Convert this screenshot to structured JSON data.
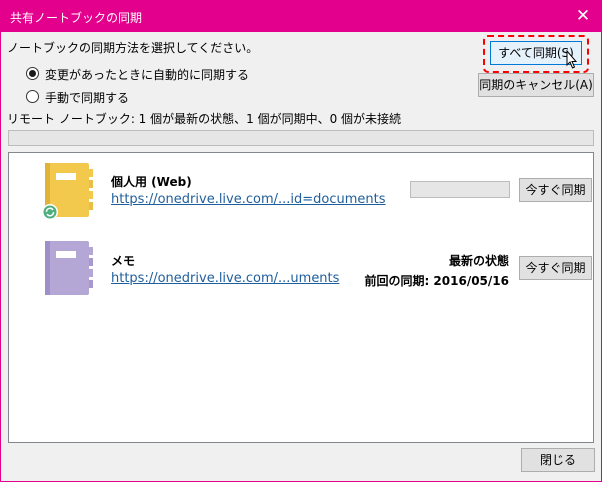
{
  "window": {
    "title": "共有ノートブックの同期"
  },
  "options": {
    "instruction": "ノートブックの同期方法を選択してください。",
    "radio_auto": "変更があったときに自動的に同期する",
    "radio_manual": "手動で同期する"
  },
  "buttons": {
    "sync_all": "すべて同期(S)",
    "cancel_sync": "同期のキャンセル(A)",
    "close": "閉じる",
    "sync_now": "今すぐ同期"
  },
  "summary": "リモート ノートブック: 1 個が最新の状態、1 個が同期中、0 個が未接続",
  "notebooks": [
    {
      "name": "個人用 (Web)",
      "url": "https://onedrive.live.com/...id=documents",
      "color": "#f2c94c",
      "syncing": true
    },
    {
      "name": "メモ",
      "url": "https://onedrive.live.com/...uments",
      "status": "最新の状態",
      "last_sync": "前回の同期: 2016/05/16",
      "color": "#b4a7d6"
    }
  ],
  "colors": {
    "accent": "#e3008c",
    "link": "#1f5e9c"
  }
}
